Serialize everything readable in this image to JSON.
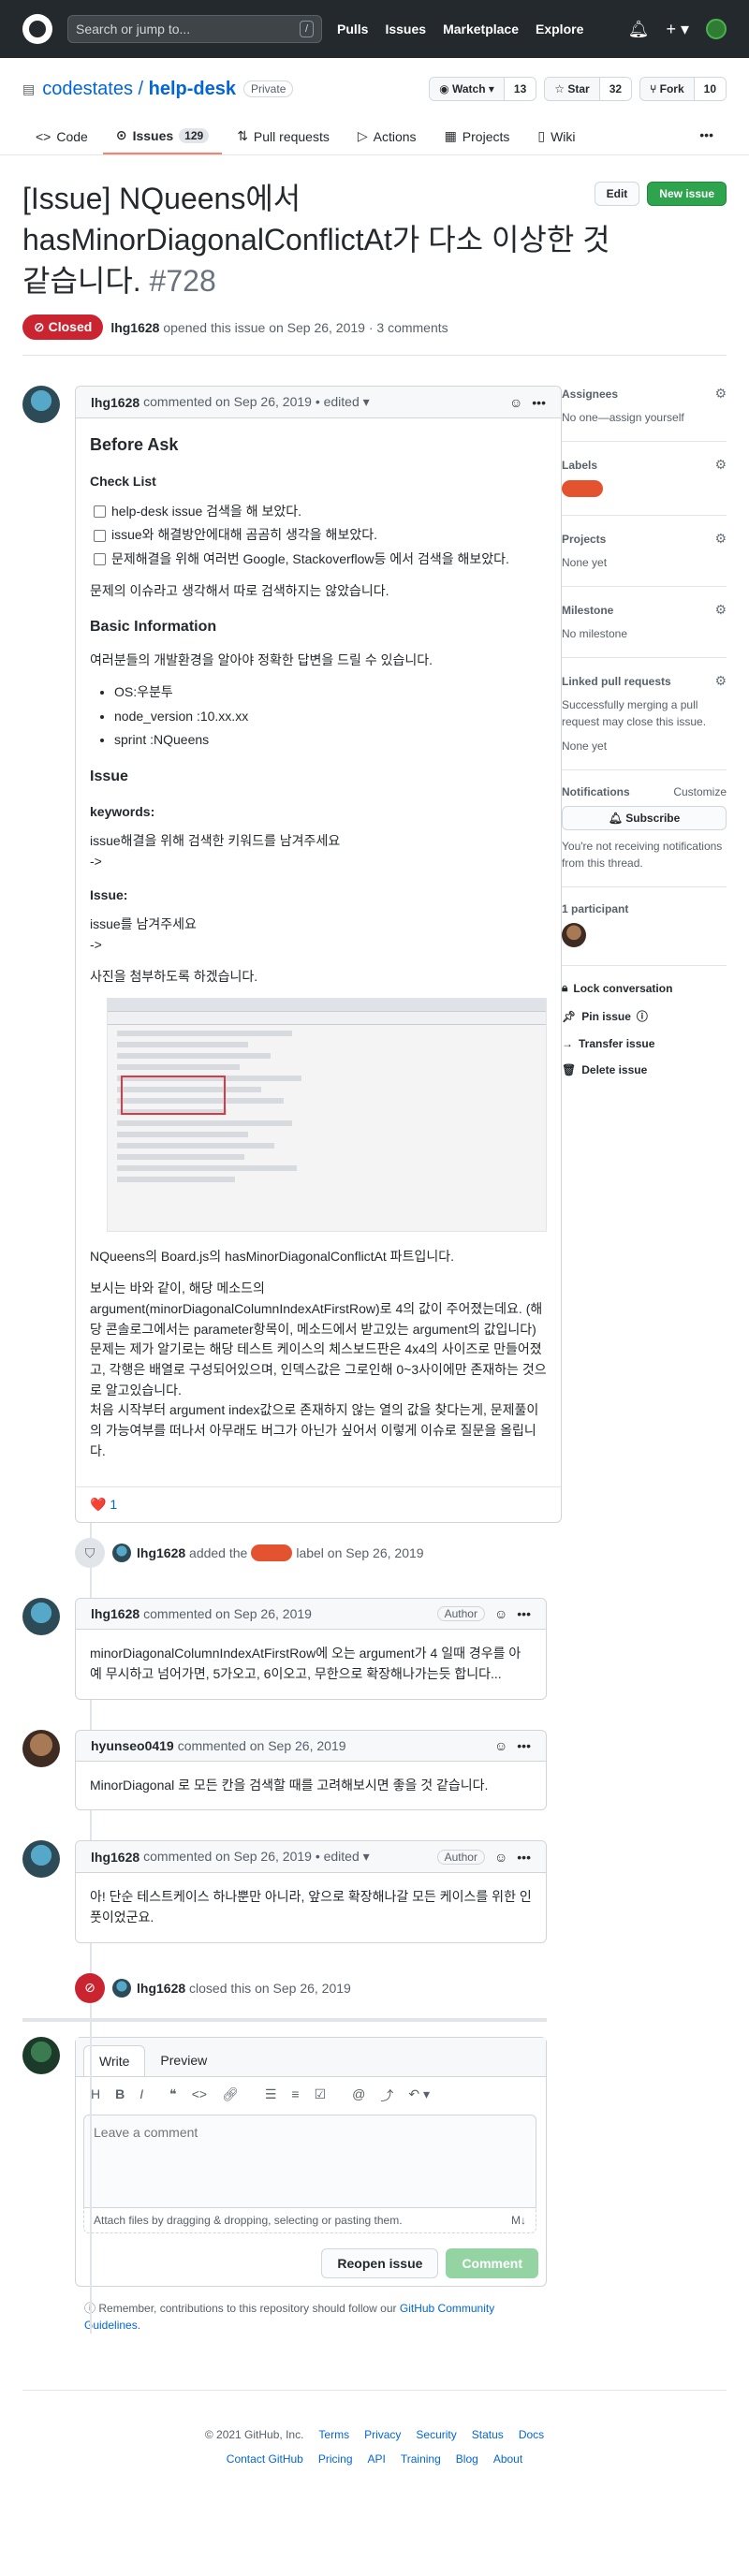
{
  "topbar": {
    "search_placeholder": "Search or jump to...",
    "search_shortcut": "/",
    "nav": [
      "Pulls",
      "Issues",
      "Marketplace",
      "Explore"
    ]
  },
  "repo": {
    "owner": "codestates",
    "sep": "/",
    "name": "help-desk",
    "visibility": "Private",
    "watch_label": "Watch",
    "watch_count": "13",
    "star_label": "Star",
    "star_count": "32",
    "fork_label": "Fork",
    "fork_count": "10"
  },
  "tabs": [
    {
      "label": "Code"
    },
    {
      "label": "Issues",
      "count": "129"
    },
    {
      "label": "Pull requests"
    },
    {
      "label": "Actions"
    },
    {
      "label": "Projects"
    },
    {
      "label": "Wiki"
    }
  ],
  "issue": {
    "title": "[Issue] NQueens에서 hasMinorDiagonalConflictAt가 다소 이상한 것 같습니다.",
    "number": "#728",
    "edit_label": "Edit",
    "new_label": "New issue",
    "state": "Closed",
    "author": "lhg1628",
    "opened_text": "opened this issue on Sep 26, 2019 · 3 comments"
  },
  "first_comment": {
    "author": "lhg1628",
    "meta": "commented on Sep 26, 2019 • edited ▾",
    "h_before": "Before Ask",
    "h_check": "Check List",
    "tasks": [
      "help-desk issue 검색을 해 보았다.",
      "issue와 해결방안에대해 곰곰히 생각을 해보았다.",
      "문제해결을 위해 여러번 Google, Stackoverflow등 에서 검색을 해보았다."
    ],
    "p_search": "문제의 이슈라고 생각해서 따로 검색하지는 않았습니다.",
    "h_basic": "Basic Information",
    "p_env": "여러분들의 개발환경을 알아야 정확한 답변을 드릴 수 있습니다.",
    "env": [
      "OS:우분투",
      "node_version :10.xx.xx",
      "sprint :NQueens"
    ],
    "h_issue": "Issue",
    "h_keywords": "keywords:",
    "p_keywords": "issue해결을 위해 검색한 키워드를 남겨주세요",
    "arrow": "->",
    "h_issue2": "Issue:",
    "p_issue2": "issue를 남겨주세요",
    "p_photo": "사진을 첨부하도록 하겠습니다.",
    "p_part": "NQueens의 Board.js의 hasMinorDiagonalConflictAt 파트입니다.",
    "p_body1": "보시는 바와 같이, 해당 메소드의 argument(minorDiagonalColumnIndexAtFirstRow)로 4의 값이 주어졌는데요. (해당 콘솔로그에서는 parameter항목이, 메소드에서 받고있는 argument의 값입니다)",
    "p_body2": "문제는 제가 알기로는 해당 테스트 케이스의 체스보드판은 4x4의 사이즈로 만들어졌고, 각행은 배열로 구성되어있으며, 인덱스값은 그로인해 0~3사이에만 존재하는 것으로 알고있습니다.",
    "p_body3": "처음 시작부터 argument index값으로 존재하지 않는 열의 값을 찾다는게, 문제풀이의 가능여부를 떠나서 아무래도 버그가 아닌가 싶어서 이렇게 이슈로 질문을 올립니다.",
    "reaction_emoji": "❤️",
    "reaction_count": "1"
  },
  "label_event": {
    "author": "lhg1628",
    "pre": "added the",
    "post": "label on Sep 26, 2019"
  },
  "comments": [
    {
      "author": "lhg1628",
      "meta": "commented on Sep 26, 2019",
      "badge": "Author",
      "body": "minorDiagonalColumnIndexAtFirstRow에 오는 argument가 4 일때 경우를 아예 무시하고 넘어가면, 5가오고, 6이오고, 무한으로 확장해나가는듯 합니다..."
    },
    {
      "author": "hyunseo0419",
      "meta": "commented on Sep 26, 2019",
      "badge": "",
      "body": "MinorDiagonal 로 모든 칸을 검색할 때를 고려해보시면 좋을 것 같습니다."
    },
    {
      "author": "lhg1628",
      "meta": "commented on Sep 26, 2019 • edited ▾",
      "badge": "Author",
      "body": "아! 단순 테스트케이스 하나뿐만 아니라, 앞으로 확장해나갈 모든 케이스를 위한 인풋이었군요."
    }
  ],
  "close_event": {
    "author": "lhg1628",
    "text": "closed this on Sep 26, 2019"
  },
  "editor": {
    "tab_write": "Write",
    "tab_preview": "Preview",
    "placeholder": "Leave a comment",
    "attach_text": "Attach files by dragging & dropping, selecting or pasting them.",
    "reopen_label": "Reopen issue",
    "comment_label": "Comment",
    "remember_pre": "Remember, contributions to this repository should follow our",
    "remember_link": "GitHub Community Guidelines",
    "remember_post": "."
  },
  "sidebar": {
    "assignees_title": "Assignees",
    "assignees_text": "No one—assign yourself",
    "labels_title": "Labels",
    "projects_title": "Projects",
    "projects_text": "None yet",
    "milestone_title": "Milestone",
    "milestone_text": "No milestone",
    "linked_title": "Linked pull requests",
    "linked_text": "Successfully merging a pull request may close this issue.",
    "linked_none": "None yet",
    "notifications_title": "Notifications",
    "customize": "Customize",
    "subscribe_label": "Subscribe",
    "notifications_text": "You're not receiving notifications from this thread.",
    "participants_title": "1 participant",
    "lock": "Lock conversation",
    "pin": "Pin issue",
    "transfer": "Transfer issue",
    "delete": "Delete issue"
  },
  "footer": {
    "copyright": "© 2021 GitHub, Inc.",
    "row1": [
      "Terms",
      "Privacy",
      "Security",
      "Status",
      "Docs"
    ],
    "row2": [
      "Contact GitHub",
      "Pricing",
      "API",
      "Training",
      "Blog",
      "About"
    ]
  },
  "colors": {
    "closed": "#cb2431",
    "label": "#e4532f",
    "new_issue": "#2ea44f",
    "link": "#0366d6"
  }
}
